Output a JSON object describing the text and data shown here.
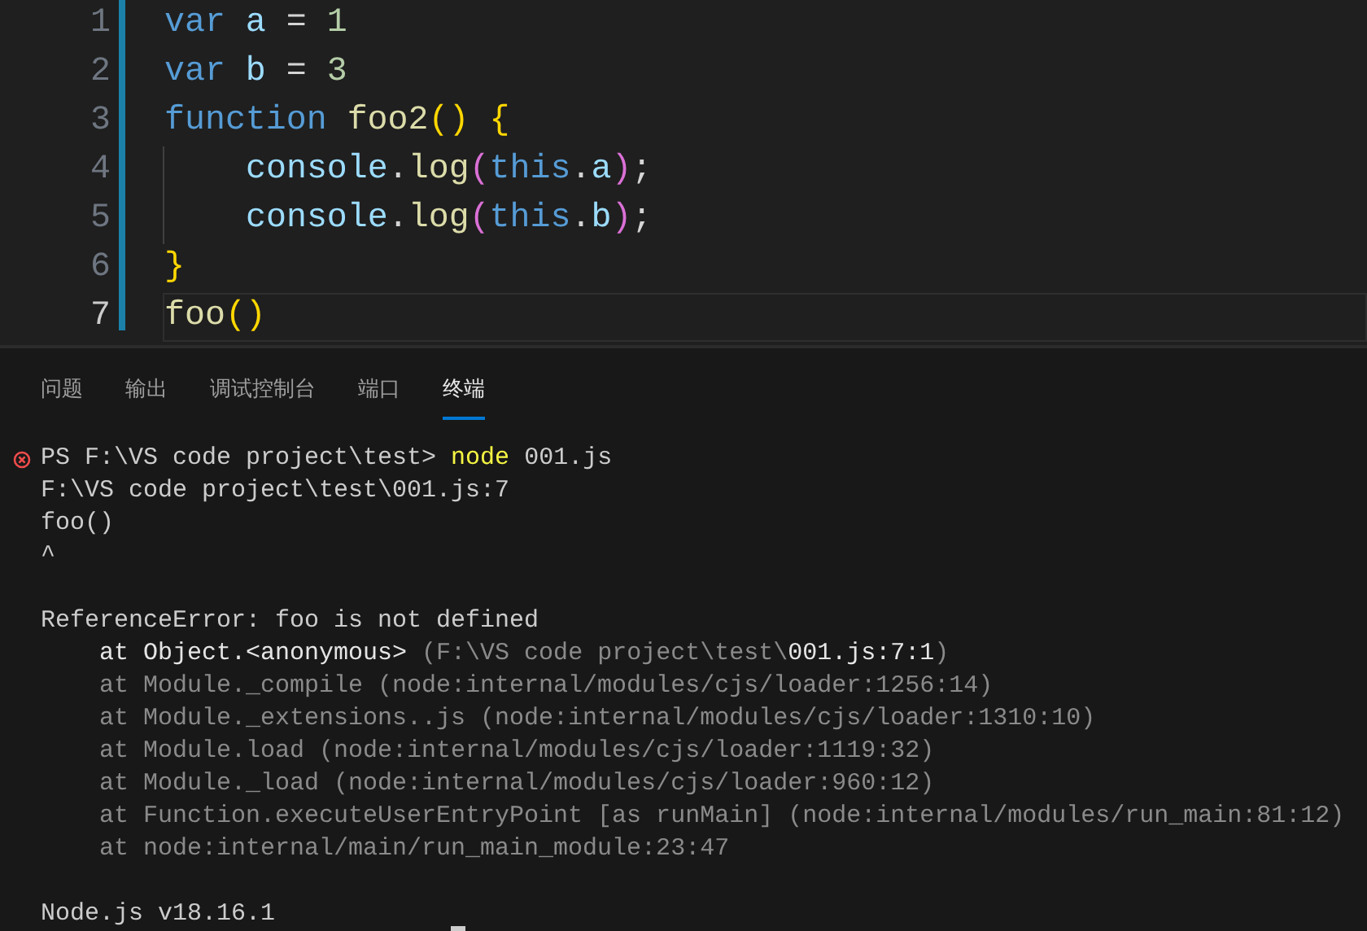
{
  "editor": {
    "lines": [
      {
        "number": "1",
        "active": false,
        "indented": false,
        "tokens": [
          {
            "text": "var",
            "kind": "keyword"
          },
          {
            "text": " a",
            "kind": "variable"
          },
          {
            "text": " = ",
            "kind": "plain"
          },
          {
            "text": "1",
            "kind": "number"
          }
        ]
      },
      {
        "number": "2",
        "active": false,
        "indented": false,
        "tokens": [
          {
            "text": "var",
            "kind": "keyword"
          },
          {
            "text": " b",
            "kind": "variable"
          },
          {
            "text": " = ",
            "kind": "plain"
          },
          {
            "text": "3",
            "kind": "number"
          }
        ]
      },
      {
        "number": "3",
        "active": false,
        "indented": false,
        "tokens": [
          {
            "text": "function",
            "kind": "keyword"
          },
          {
            "text": " foo2",
            "kind": "function"
          },
          {
            "text": "()",
            "kind": "bracket1"
          },
          {
            "text": " {",
            "kind": "bracket1"
          }
        ]
      },
      {
        "number": "4",
        "active": false,
        "indented": true,
        "tokens": [
          {
            "text": "console",
            "kind": "variable"
          },
          {
            "text": ".",
            "kind": "plain"
          },
          {
            "text": "log",
            "kind": "function"
          },
          {
            "text": "(",
            "kind": "bracket2"
          },
          {
            "text": "this",
            "kind": "keyword"
          },
          {
            "text": ".",
            "kind": "plain"
          },
          {
            "text": "a",
            "kind": "variable"
          },
          {
            "text": ")",
            "kind": "bracket2"
          },
          {
            "text": ";",
            "kind": "plain"
          }
        ]
      },
      {
        "number": "5",
        "active": false,
        "indented": true,
        "tokens": [
          {
            "text": "console",
            "kind": "variable"
          },
          {
            "text": ".",
            "kind": "plain"
          },
          {
            "text": "log",
            "kind": "function"
          },
          {
            "text": "(",
            "kind": "bracket2"
          },
          {
            "text": "this",
            "kind": "keyword"
          },
          {
            "text": ".",
            "kind": "plain"
          },
          {
            "text": "b",
            "kind": "variable"
          },
          {
            "text": ")",
            "kind": "bracket2"
          },
          {
            "text": ";",
            "kind": "plain"
          }
        ]
      },
      {
        "number": "6",
        "active": false,
        "indented": false,
        "tokens": [
          {
            "text": "}",
            "kind": "bracket1"
          }
        ]
      },
      {
        "number": "7",
        "active": true,
        "indented": false,
        "tokens": [
          {
            "text": "foo",
            "kind": "function"
          },
          {
            "text": "()",
            "kind": "bracket1"
          }
        ]
      }
    ]
  },
  "panel": {
    "tabs": [
      {
        "label": "问题",
        "selected": false
      },
      {
        "label": "输出",
        "selected": false
      },
      {
        "label": "调试控制台",
        "selected": false
      },
      {
        "label": "端口",
        "selected": false
      },
      {
        "label": "终端",
        "selected": true
      }
    ]
  },
  "terminal": {
    "lines": [
      {
        "kind": "text",
        "error": true,
        "segments": [
          {
            "text": "PS F:\\VS code project\\test> ",
            "kind": "normal"
          },
          {
            "text": "node",
            "kind": "command"
          },
          {
            "text": " 001.js",
            "kind": "normal"
          }
        ]
      },
      {
        "kind": "text",
        "error": false,
        "segments": [
          {
            "text": "F:\\VS code project\\test\\001.js:7",
            "kind": "normal"
          }
        ]
      },
      {
        "kind": "text",
        "error": false,
        "segments": [
          {
            "text": "foo()",
            "kind": "normal"
          }
        ]
      },
      {
        "kind": "text",
        "error": false,
        "segments": [
          {
            "text": "^",
            "kind": "normal"
          }
        ]
      },
      {
        "kind": "blank"
      },
      {
        "kind": "text",
        "error": false,
        "segments": [
          {
            "text": "ReferenceError: foo is not defined",
            "kind": "normal"
          }
        ]
      },
      {
        "kind": "text",
        "error": false,
        "segments": [
          {
            "text": "    at Object.<anonymous>",
            "kind": "bright"
          },
          {
            "text": " (F:\\VS code project\\test\\",
            "kind": "dim"
          },
          {
            "text": "001.js:7:1",
            "kind": "bright"
          },
          {
            "text": ")",
            "kind": "dim"
          }
        ]
      },
      {
        "kind": "text",
        "error": false,
        "segments": [
          {
            "text": "    at Module._compile (node:internal/modules/cjs/loader:1256:14)",
            "kind": "dim"
          }
        ]
      },
      {
        "kind": "text",
        "error": false,
        "segments": [
          {
            "text": "    at Module._extensions..js (node:internal/modules/cjs/loader:1310:10)",
            "kind": "dim"
          }
        ]
      },
      {
        "kind": "text",
        "error": false,
        "segments": [
          {
            "text": "    at Module.load (node:internal/modules/cjs/loader:1119:32)",
            "kind": "dim"
          }
        ]
      },
      {
        "kind": "text",
        "error": false,
        "segments": [
          {
            "text": "    at Module._load (node:internal/modules/cjs/loader:960:12)",
            "kind": "dim"
          }
        ]
      },
      {
        "kind": "text",
        "error": false,
        "segments": [
          {
            "text": "    at Function.executeUserEntryPoint [as runMain] (node:internal/modules/run_main:81:12)",
            "kind": "dim"
          }
        ]
      },
      {
        "kind": "text",
        "error": false,
        "segments": [
          {
            "text": "    at node:internal/main/run_main_module:23:47",
            "kind": "dim"
          }
        ]
      },
      {
        "kind": "blank"
      },
      {
        "kind": "text",
        "error": false,
        "segments": [
          {
            "text": "Node.js v18.16.1",
            "kind": "normal"
          }
        ]
      }
    ]
  }
}
